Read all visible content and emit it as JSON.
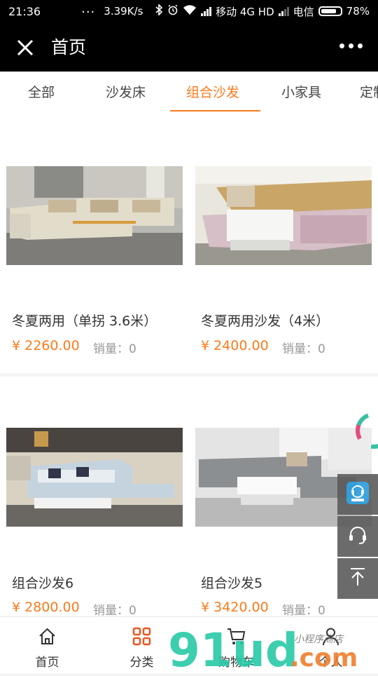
{
  "status_bar": {
    "time": "21:36",
    "dots": "...",
    "speed": "3.39K/s",
    "carrier1": "移动 4G HD",
    "carrier2": "电信",
    "battery": "78%"
  },
  "header": {
    "title": "首页",
    "close_icon": "close-icon",
    "more_icon": "more-icon"
  },
  "tabs": [
    {
      "label": "全部"
    },
    {
      "label": "沙发床"
    },
    {
      "label": "组合沙发",
      "active": true
    },
    {
      "label": "小家具"
    },
    {
      "label": "定制"
    }
  ],
  "products": [
    {
      "name": "冬夏两用（单拐 3.6米）",
      "price": "¥ 2260.00",
      "sales": "销量：0"
    },
    {
      "name": "冬夏两用沙发（4米）",
      "price": "¥ 2400.00",
      "sales": "销量：0"
    },
    {
      "name": "组合沙发6",
      "price": "¥ 2800.00",
      "sales": "销量：0"
    },
    {
      "name": "组合沙发5",
      "price": "¥ 3420.00",
      "sales": "销量：0"
    }
  ],
  "floating_buttons": [
    "customer-service-icon",
    "headset-icon",
    "back-to-top-icon"
  ],
  "bottom_nav": [
    {
      "label": "首页",
      "icon": "home-icon"
    },
    {
      "label": "分类",
      "icon": "category-icon"
    },
    {
      "label": "购物车",
      "icon": "cart-icon"
    },
    {
      "label": "个人",
      "icon": "user-icon"
    }
  ],
  "watermark": {
    "text": "91ud",
    "domain": ".com",
    "tagline": "小程序商店"
  },
  "colors": {
    "accent": "#ff7a1a",
    "header_bg": "#000000",
    "watermark": "#27c9a6"
  }
}
